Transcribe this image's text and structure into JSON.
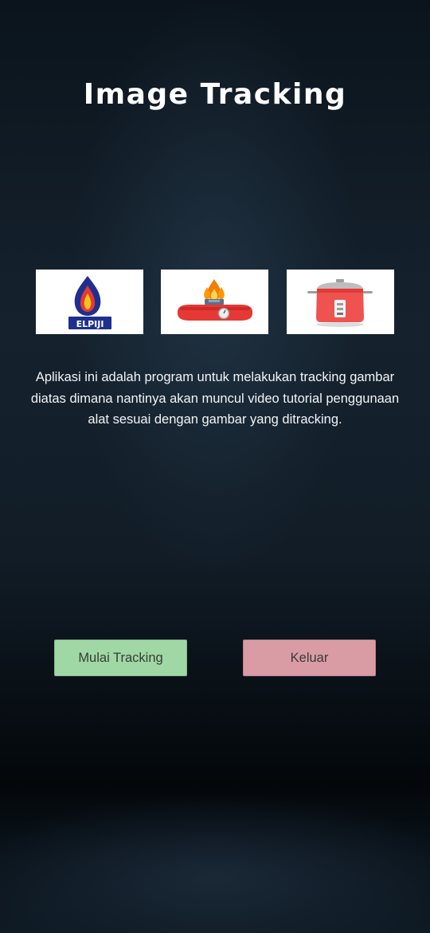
{
  "header": {
    "title": "Image Tracking"
  },
  "images": [
    {
      "name": "elpiji-logo",
      "label": "ELPIJI"
    },
    {
      "name": "gas-stove-illustration"
    },
    {
      "name": "rice-cooker-illustration"
    }
  ],
  "description": "Aplikasi ini adalah program untuk melakukan tracking gambar diatas dimana nantinya akan muncul video tutorial penggunaan alat sesuai dengan gambar yang ditracking.",
  "buttons": {
    "start_label": "Mulai Tracking",
    "exit_label": "Keluar"
  },
  "colors": {
    "start_button": "#9fd8a4",
    "exit_button": "#d99ca4",
    "elpiji_blue": "#1e2f8f",
    "appliance_red": "#e53935"
  }
}
